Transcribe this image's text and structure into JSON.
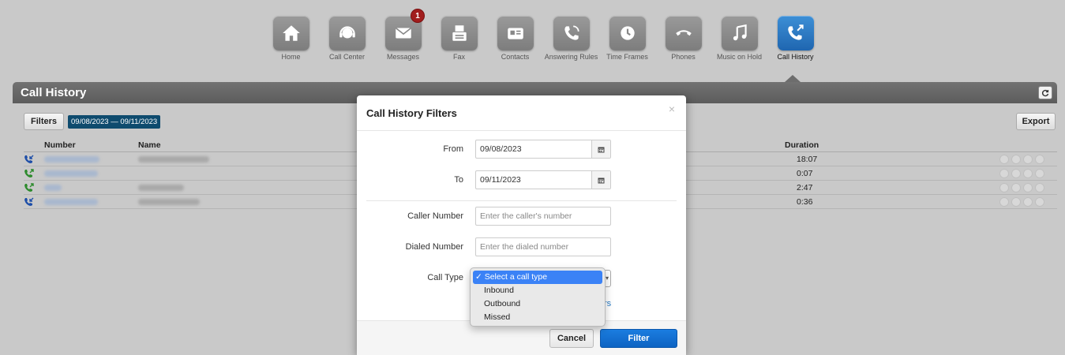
{
  "nav": {
    "items": [
      {
        "label": "Home",
        "icon": "home-icon"
      },
      {
        "label": "Call Center",
        "icon": "headset-icon"
      },
      {
        "label": "Messages",
        "icon": "envelope-icon",
        "badge": "1"
      },
      {
        "label": "Fax",
        "icon": "fax-icon"
      },
      {
        "label": "Contacts",
        "icon": "contact-card-icon"
      },
      {
        "label": "Answering Rules",
        "icon": "phone-rules-icon"
      },
      {
        "label": "Time Frames",
        "icon": "clock-icon"
      },
      {
        "label": "Phones",
        "icon": "phone-handset-icon"
      },
      {
        "label": "Music on Hold",
        "icon": "music-note-icon"
      },
      {
        "label": "Call History",
        "icon": "call-history-icon",
        "active": true
      }
    ]
  },
  "section": {
    "title": "Call History"
  },
  "toolbar": {
    "filters_label": "Filters",
    "date_range": "09/08/2023 — 09/11/2023",
    "export_label": "Export"
  },
  "table": {
    "headers": {
      "number": "Number",
      "name": "Name",
      "duration": "Duration"
    },
    "rows": [
      {
        "direction": "inbound",
        "duration": "18:07"
      },
      {
        "direction": "outbound",
        "duration": "0:07"
      },
      {
        "direction": "outbound",
        "duration": "2:47"
      },
      {
        "direction": "inbound",
        "duration": "0:36"
      }
    ]
  },
  "modal": {
    "title": "Call History Filters",
    "close": "×",
    "from_label": "From",
    "from_value": "09/08/2023",
    "to_label": "To",
    "to_value": "09/11/2023",
    "caller_label": "Caller Number",
    "caller_placeholder": "Enter the caller's number",
    "dialed_label": "Dialed Number",
    "dialed_placeholder": "Enter the dialed number",
    "calltype_label": "Call Type",
    "link_fragment": "rs",
    "cancel_label": "Cancel",
    "filter_label": "Filter"
  },
  "dropdown": {
    "options": [
      "✓ Select a call type",
      "Inbound",
      "Outbound",
      "Missed"
    ],
    "selected_index": 0
  },
  "colors": {
    "accent": "#1b7de0",
    "inbound_icon": "#1f4fa8",
    "outbound_icon": "#2e8b2e",
    "badge": "#a11d1d"
  }
}
